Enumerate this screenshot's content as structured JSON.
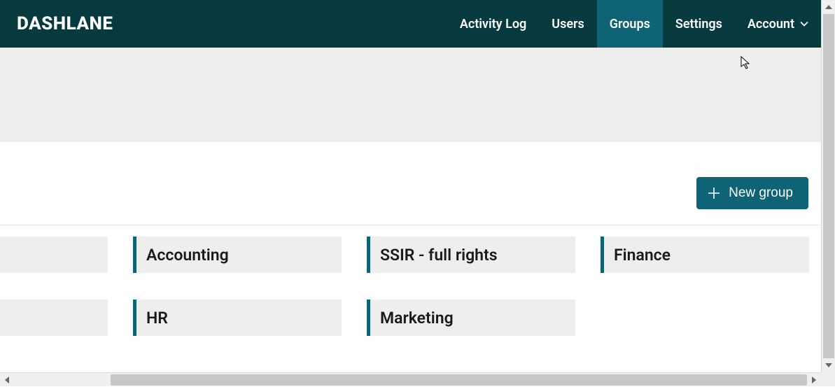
{
  "header": {
    "logo": "DASHLANE",
    "nav": [
      {
        "label": "Activity Log",
        "active": false
      },
      {
        "label": "Users",
        "active": false
      },
      {
        "label": "Groups",
        "active": true
      },
      {
        "label": "Settings",
        "active": false
      },
      {
        "label": "Account",
        "active": false,
        "has_dropdown": true
      }
    ]
  },
  "actions": {
    "new_group_label": "New group"
  },
  "groups": {
    "row1": [
      {
        "name": ""
      },
      {
        "name": "Accounting"
      },
      {
        "name": "SSIR - full rights"
      },
      {
        "name": "Finance"
      }
    ],
    "row2": [
      {
        "name": ""
      },
      {
        "name": "HR"
      },
      {
        "name": "Marketing"
      }
    ]
  }
}
